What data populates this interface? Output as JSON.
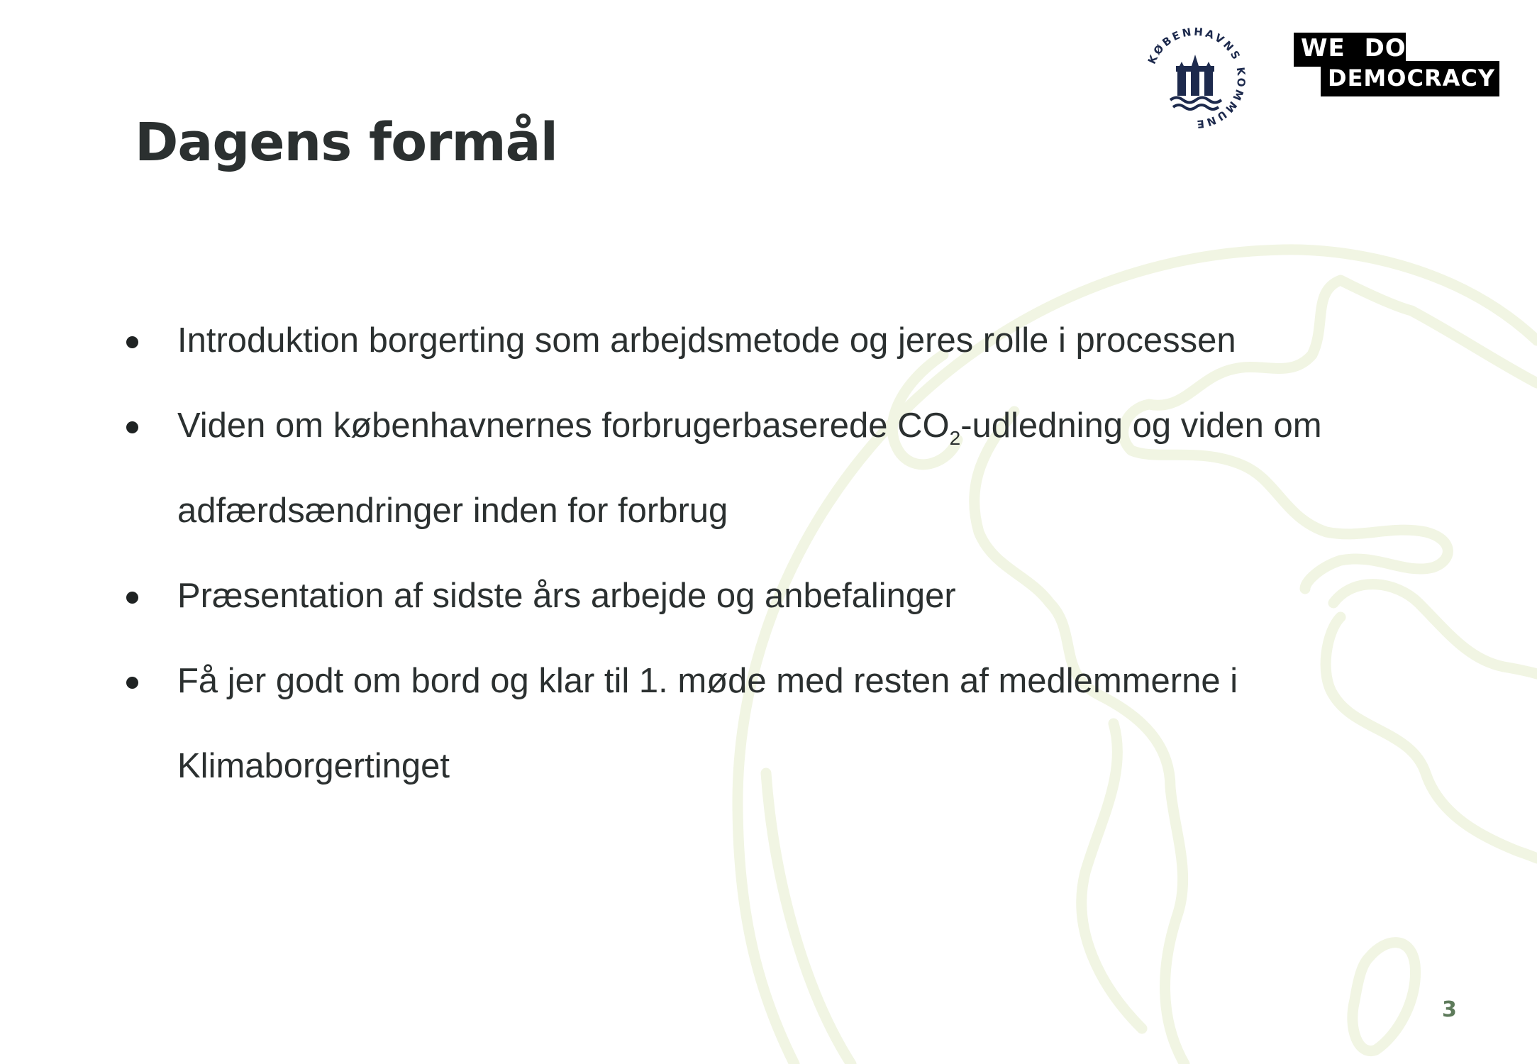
{
  "slide": {
    "title": "Dagens formål",
    "bullets": [
      {
        "text": "Introduktion borgerting som arbejdsmetode og jeres rolle i processen"
      },
      {
        "before": "Viden om københavnernes forbrugerbaserede CO",
        "sub": "2",
        "after": "-udledning og viden om adfærdsændringer inden for forbrug"
      },
      {
        "text": "Præsentation af sidste års arbejde og anbefalinger"
      },
      {
        "text": "Få jer godt om bord og klar til 1. møde med resten af medlemmerne i Klimaborgertinget"
      }
    ],
    "page_number": "3"
  },
  "logos": {
    "kobenhavn_ring_text": "KØBENHAVNS KOMMUNE",
    "wedodemocracy_line1": "WE DO",
    "wedodemocracy_line2": "DEMOCRACY"
  },
  "colors": {
    "text": "#2b3030",
    "globe_outline": "#f1f5e3",
    "logo_navy": "#1d2a4d",
    "page_number": "#5d7a5a"
  },
  "icons": {
    "background": "globe-outline",
    "bullet": "filled-circle"
  }
}
